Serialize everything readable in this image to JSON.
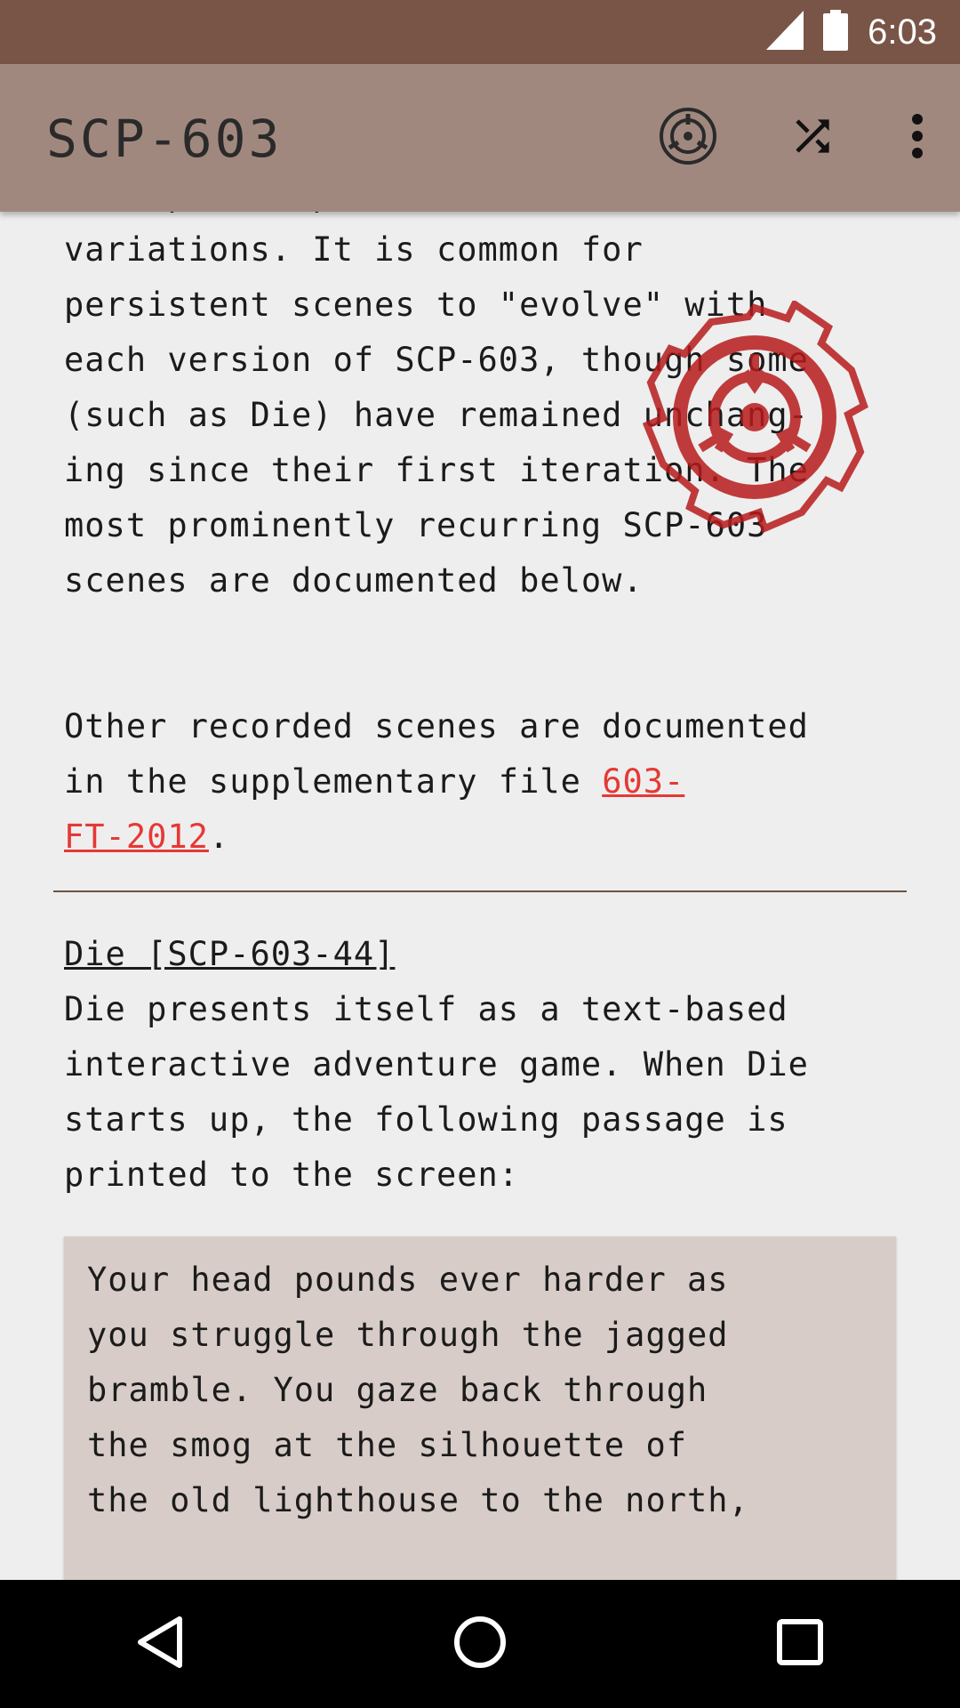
{
  "status": {
    "time": "6:03"
  },
  "app_bar": {
    "title": "SCP-603",
    "actions": [
      "scp-logo-icon",
      "shuffle-icon",
      "more-vert-icon"
    ]
  },
  "article": {
    "p_cut": "multiple compilations, often with",
    "p1": "variations. It is common for\npersistent scenes to \"evolve\" with\neach version of SCP-603, though some\n(such as Die) have remained unchang-\ning since their first iteration. The\nmost prominently recurring SCP-603\nscenes are documented below.",
    "p2_before": "Other recorded scenes are documented\nin the supplementary file ",
    "p2_link": "603-\nFT-2012",
    "p2_after": ".",
    "heading": "Die [SCP-603-44]",
    "p3": "Die presents itself as a text-based\ninteractive adventure game. When Die\nstarts up, the following passage is\nprinted to the screen:",
    "quote": "Your head pounds ever harder as\nyou struggle through the jagged\nbramble. You gaze back through\nthe smog at the silhouette of\nthe old lighthouse to the north,"
  },
  "colors": {
    "status_bar": "#795548",
    "app_bar": "#a1887f",
    "link": "#e53935",
    "quote_bg": "#d7ccc8",
    "seal": "#b71c1c"
  },
  "nav": [
    "back-icon",
    "home-icon",
    "recents-icon"
  ]
}
